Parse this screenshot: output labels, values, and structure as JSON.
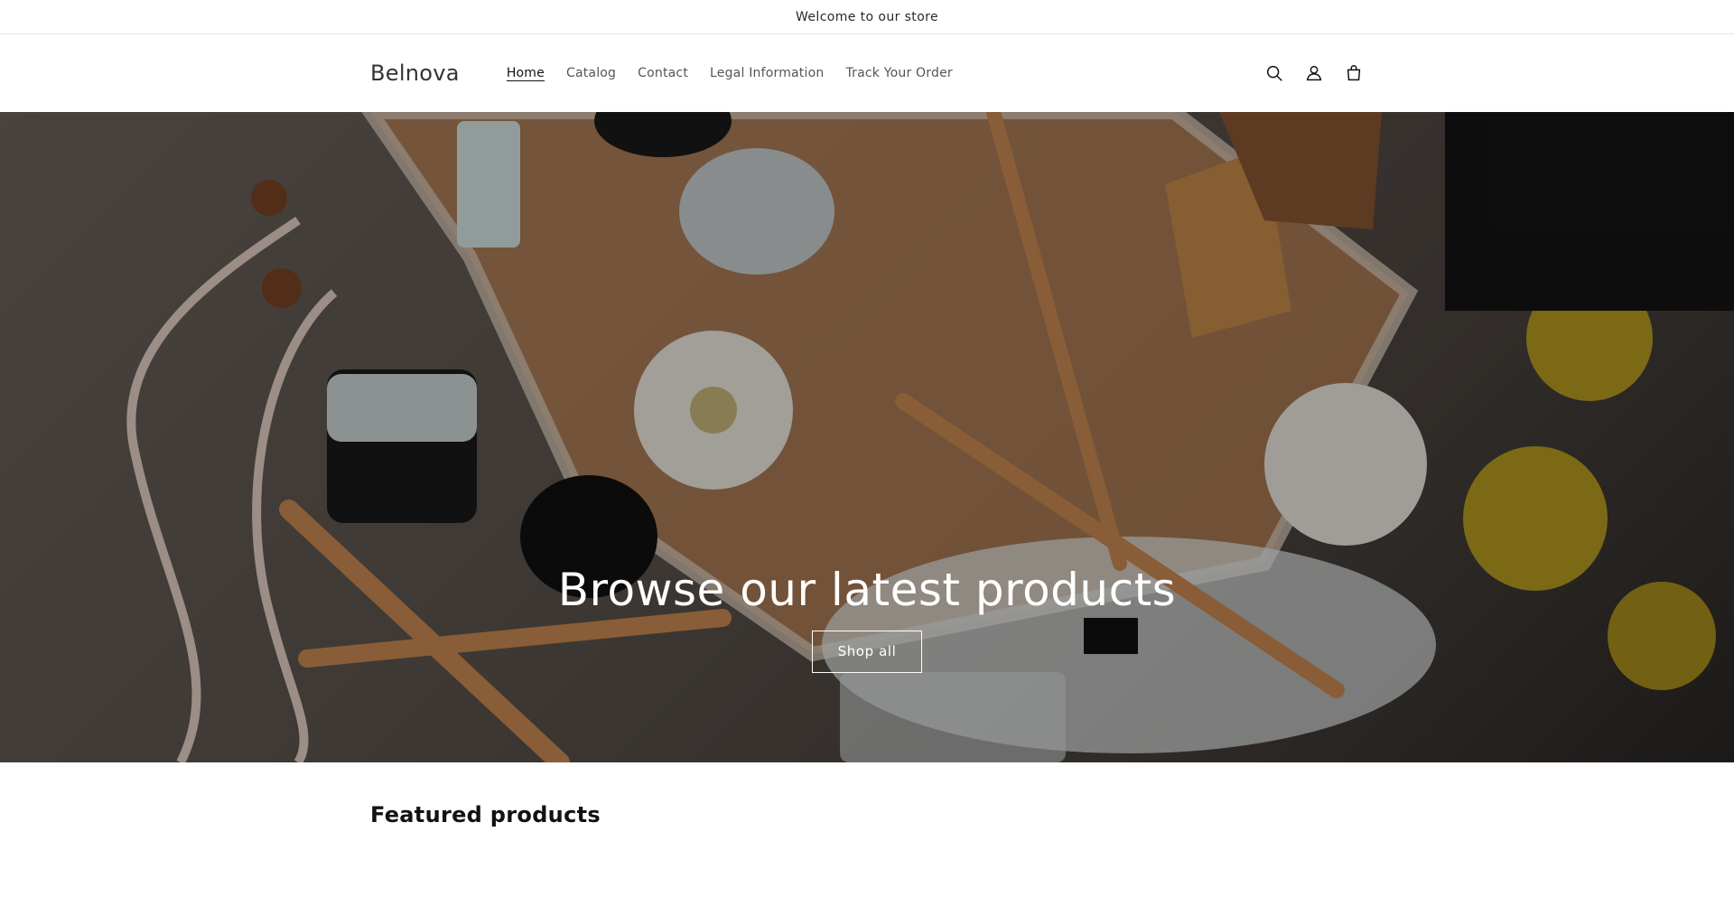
{
  "announcement": {
    "text": "Welcome to our store"
  },
  "header": {
    "logo": "Belnova",
    "nav": [
      {
        "label": "Home",
        "active": true
      },
      {
        "label": "Catalog",
        "active": false
      },
      {
        "label": "Contact",
        "active": false
      },
      {
        "label": "Legal Information",
        "active": false
      },
      {
        "label": "Track Your Order",
        "active": false
      }
    ],
    "icons": [
      "search-icon",
      "account-icon",
      "cart-icon"
    ]
  },
  "hero": {
    "title": "Browse our latest products",
    "button_label": "Shop all"
  },
  "featured": {
    "heading": "Featured products"
  },
  "colors": {
    "text": "#121212",
    "overlay": "rgba(0,0,0,0.32)",
    "white": "#ffffff"
  }
}
